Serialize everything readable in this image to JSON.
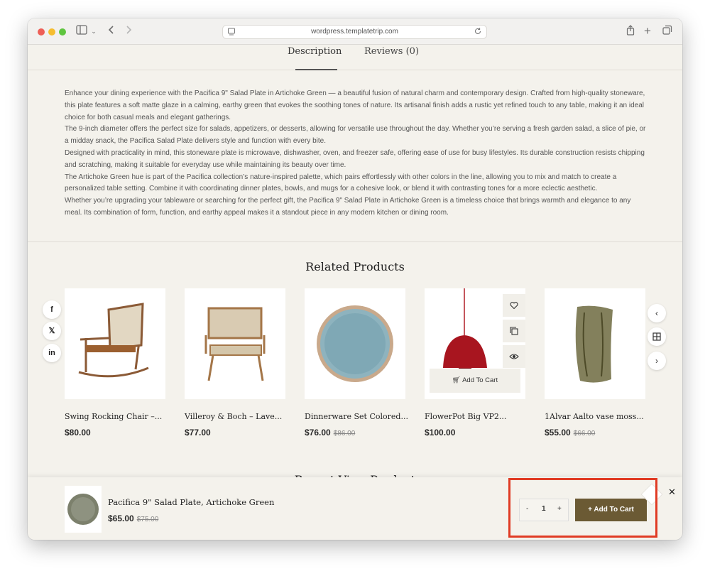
{
  "browser": {
    "url": "wordpress.templatetrip.com"
  },
  "tabs": {
    "description": "Description",
    "reviews": "Reviews (0)"
  },
  "description": {
    "p1": "Enhance your dining experience with the Pacifica 9\" Salad Plate in Artichoke Green — a beautiful fusion of natural charm and contemporary design. Crafted from high-quality stoneware, this plate features a soft matte glaze in a calming, earthy green that evokes the soothing tones of nature. Its artisanal finish adds a rustic yet refined touch to any table, making it an ideal choice for both casual meals and elegant gatherings.",
    "p2": "The 9-inch diameter offers the perfect size for salads, appetizers, or desserts, allowing for versatile use throughout the day. Whether you’re serving a fresh garden salad, a slice of pie, or a midday snack, the Pacifica Salad Plate delivers style and function with every bite.",
    "p3": "Designed with practicality in mind, this stoneware plate is microwave, dishwasher, oven, and freezer safe, offering ease of use for busy lifestyles. Its durable construction resists chipping and scratching, making it suitable for everyday use while maintaining its beauty over time.",
    "p4": "The Artichoke Green hue is part of the Pacifica collection’s nature-inspired palette, which pairs effortlessly with other colors in the line, allowing you to mix and match to create a personalized table setting. Combine it with coordinating dinner plates, bowls, and mugs for a cohesive look, or blend it with contrasting tones for a more eclectic aesthetic.",
    "p5": "Whether you’re upgrading your tableware or searching for the perfect gift, the Pacifica 9\" Salad Plate in Artichoke Green is a timeless choice that brings warmth and elegance to any meal. Its combination of form, function, and earthy appeal makes it a standout piece in any modern kitchen or dining room."
  },
  "related": {
    "title": "Related Products",
    "products": [
      {
        "name": "Swing Rocking Chair –...",
        "price": "$80.00",
        "old_price": ""
      },
      {
        "name": "Villeroy & Boch – Lave...",
        "price": "$77.00",
        "old_price": ""
      },
      {
        "name": "Dinnerware Set Colored...",
        "price": "$76.00",
        "old_price": "$86.00"
      },
      {
        "name": "FlowerPot Big VP2...",
        "price": "$100.00",
        "old_price": "",
        "hover_cart_label": "Add To Cart"
      },
      {
        "name": "1Alvar Aalto vase moss...",
        "price": "$55.00",
        "old_price": "$66.00"
      }
    ]
  },
  "recent": {
    "title_peek": "Recent View Product"
  },
  "sticky_bar": {
    "product_name": "Pacifica 9\" Salad Plate, Artichoke Green",
    "price": "$65.00",
    "old_price": "$75.00",
    "qty_minus": "-",
    "qty_value": "1",
    "qty_plus": "+",
    "add_to_cart": "Add To Cart"
  },
  "colors": {
    "accent_button": "#6b5a34",
    "highlight_box": "#e03b24",
    "page_bg": "#f4f2ec"
  }
}
